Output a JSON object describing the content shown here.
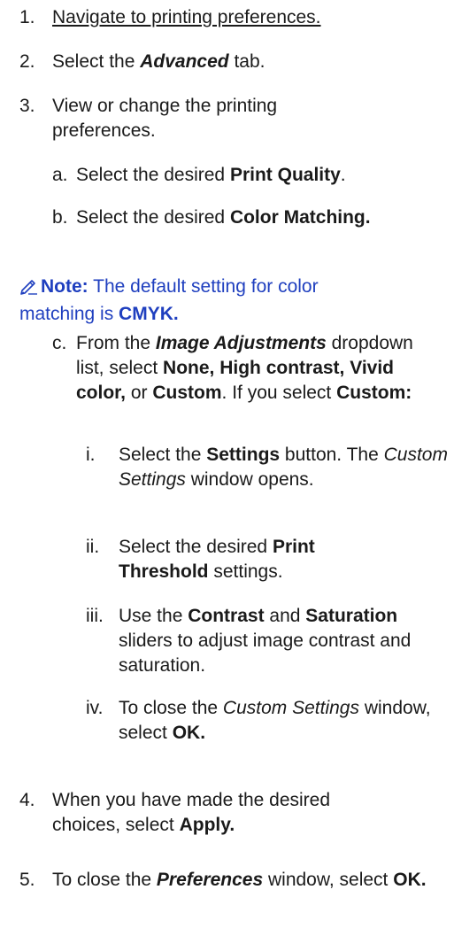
{
  "steps": {
    "s1": {
      "num": "1.",
      "link": "Navigate to printing preferences."
    },
    "s2": {
      "num": "2.",
      "pre": "Select the ",
      "em": "Advanced",
      "post": " tab."
    },
    "s3": {
      "num": "3.",
      "text": "View or change the printing preferences."
    },
    "s3a": {
      "num": "a.",
      "pre": "Select the desired ",
      "b": "Print Quality",
      "post": "."
    },
    "s3b": {
      "num": "b.",
      "pre": "Select the desired ",
      "b": "Color Matching."
    },
    "note": {
      "label": "Note:",
      "pre": " The default setting for color matching is ",
      "b": "CMYK."
    },
    "s3c": {
      "num": "c.",
      "t1": "From the ",
      "em": "Image Adjustments",
      "t2": " dropdown list, select ",
      "b1": "None, High contrast, Vivid color,",
      "t3": " or ",
      "b2": "Custom",
      "t4": ". If you select ",
      "b3": "Custom:"
    },
    "s3c1": {
      "num": "i.",
      "t1": "Select the ",
      "b": "Settings",
      "t2": " button. The ",
      "i": "Custom Settings",
      "t3": " window opens."
    },
    "s3c2": {
      "num": "ii.",
      "t1": "Select the desired ",
      "b": "Print Threshold",
      "t2": " settings."
    },
    "s3c3": {
      "num": "iii.",
      "t1": "Use the ",
      "b1": "Contrast",
      "t2": " and ",
      "b2": "Saturation",
      "t3": " sliders to adjust image contrast and saturation."
    },
    "s3c4": {
      "num": "iv.",
      "t1": "To close the ",
      "i": "Custom Settings",
      "t2": " window, select ",
      "b": "OK."
    },
    "s4": {
      "num": "4.",
      "t1": "When you have made the desired choices, select ",
      "b": "Apply."
    },
    "s5": {
      "num": "5.",
      "t1": "To close the ",
      "em": "Preferences",
      "t2": " window, select ",
      "b": "OK."
    }
  },
  "icons": {
    "note": "pencil-icon"
  },
  "colors": {
    "note_text": "#1f3fbf",
    "body_text": "#1a1a1a"
  }
}
